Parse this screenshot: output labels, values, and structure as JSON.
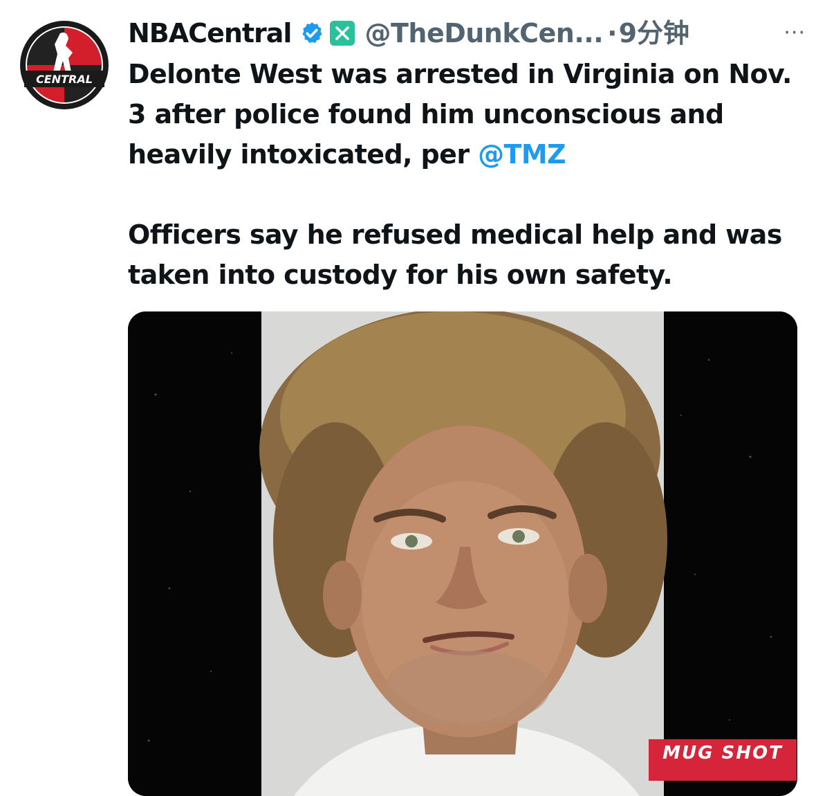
{
  "header": {
    "display_name": "NBACentral",
    "handle": "@TheDunkCen...",
    "separator": "·",
    "time": "9分钟",
    "more": "···",
    "avatar_text": "CENTRAL",
    "verified_icon": "verified-badge-icon",
    "x_icon": "x-logo-icon"
  },
  "tweet": {
    "paragraph1_text": "Delonte West was arrested in Virginia on Nov. 3 after police found him unconscious and heavily intoxicated, per ",
    "mention": "@TMZ",
    "paragraph2_text": "Officers say he refused medical help and was taken into custody for his own safety."
  },
  "media": {
    "label": "MUG SHOT",
    "subject": "mug-shot-photo"
  },
  "colors": {
    "accent": "#1d9bf0",
    "label_red": "#d6253a",
    "x_green": "#27c29a"
  }
}
